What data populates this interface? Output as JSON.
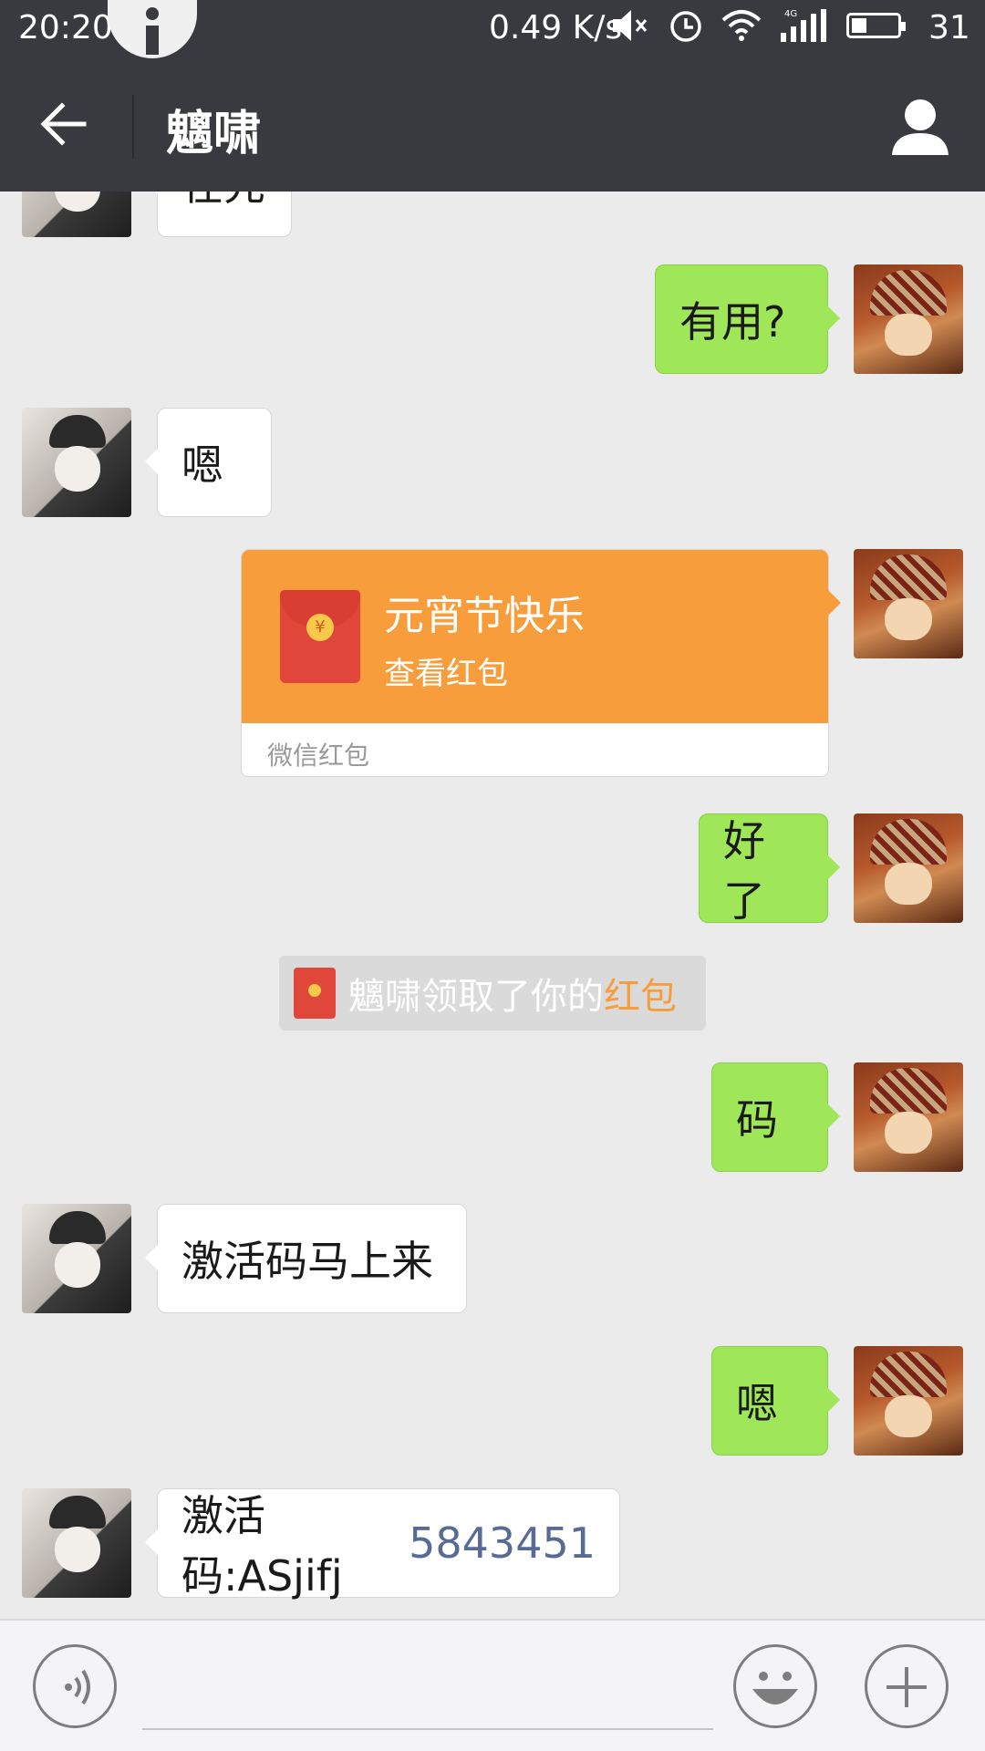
{
  "status_bar": {
    "time": "20:20",
    "speed": "0.49 K/s",
    "battery": "31",
    "icons": [
      "info-icon",
      "mute-icon",
      "alarm-icon",
      "wifi-icon",
      "signal-4g-icon",
      "battery-icon"
    ]
  },
  "header": {
    "title": "魑啸",
    "back_icon": "back-arrow-icon",
    "profile_icon": "person-icon"
  },
  "messages": [
    {
      "from": "them",
      "text": "在先"
    },
    {
      "from": "me",
      "text": "有用?"
    },
    {
      "from": "them",
      "text": "嗯"
    },
    {
      "from": "me",
      "type": "red_packet",
      "title": "元宵节快乐",
      "subtitle": "查看红包",
      "footer": "微信红包"
    },
    {
      "from": "me",
      "text": "好了"
    },
    {
      "from": "system",
      "prefix": "魑啸领取了你的",
      "highlight": "红包"
    },
    {
      "from": "me",
      "text": "码"
    },
    {
      "from": "them",
      "text": "激活码马上来"
    },
    {
      "from": "me",
      "text": "嗯"
    },
    {
      "from": "them",
      "text_plain": "激活码:ASjifj",
      "text_link": "5843451"
    }
  ],
  "colors": {
    "header_bg": "#393a3f",
    "chat_bg": "#ebebeb",
    "my_bubble": "#9fe658",
    "red_packet": "#f79d3c",
    "link": "#576b95"
  },
  "bottom_bar": {
    "voice_icon": "voice-icon",
    "emoji_icon": "smiley-icon",
    "plus_icon": "plus-icon"
  }
}
